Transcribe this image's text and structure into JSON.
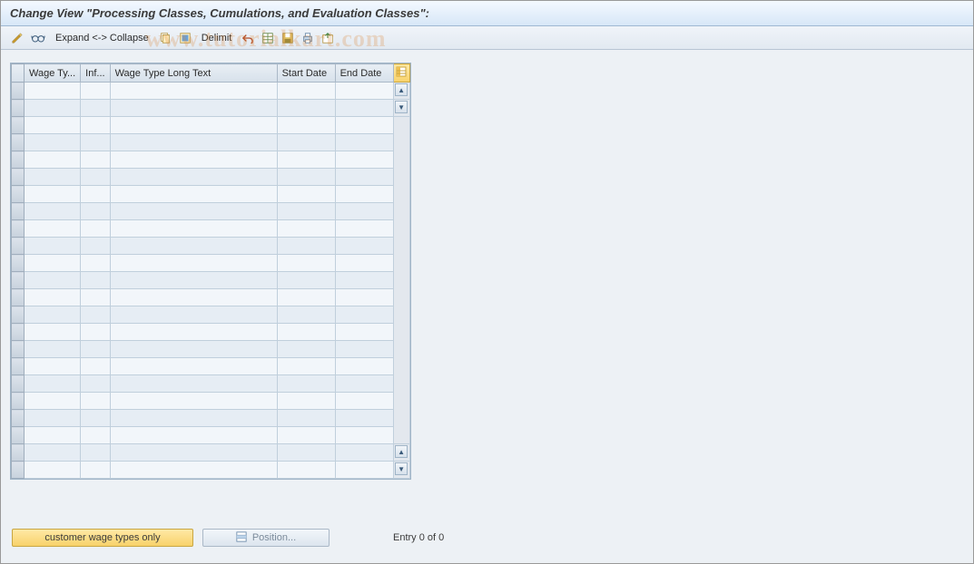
{
  "title": "Change View \"Processing Classes, Cumulations, and Evaluation Classes\":",
  "toolbar": {
    "expand_collapse": "Expand <-> Collapse",
    "delimit": "Delimit"
  },
  "table": {
    "columns": {
      "wage_type": "Wage Ty...",
      "info": "Inf...",
      "wage_type_long": "Wage Type Long Text",
      "start_date": "Start Date",
      "end_date": "End Date"
    },
    "row_count": 23
  },
  "bottom": {
    "customer_btn": "customer wage types only",
    "position_btn": "Position...",
    "entry_text": "Entry 0 of 0"
  },
  "watermark": "www.tutorialkart.com"
}
